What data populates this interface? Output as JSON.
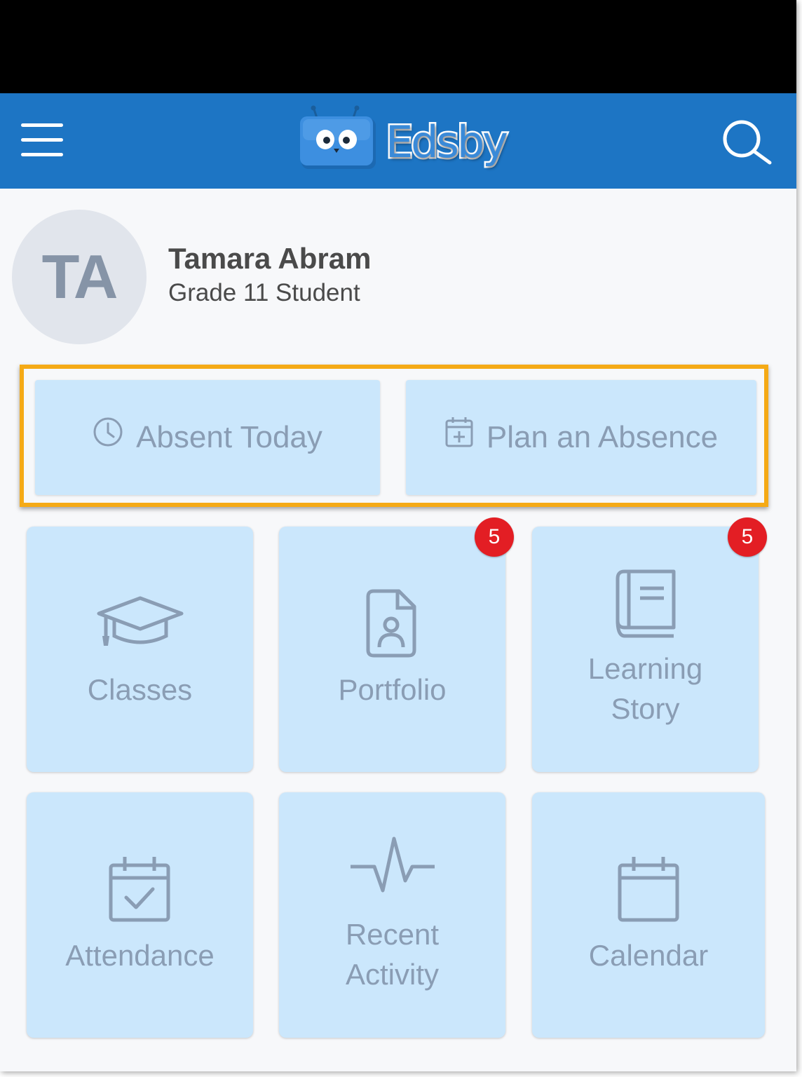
{
  "app": {
    "name": "Edsby"
  },
  "user": {
    "initials": "TA",
    "name": "Tamara Abram",
    "role": "Grade 11 Student"
  },
  "absence_actions": [
    {
      "label": "Absent Today",
      "icon": "clock-icon"
    },
    {
      "label": "Plan an Absence",
      "icon": "calendar-plus-icon"
    }
  ],
  "tiles": [
    {
      "label_line1": "Classes",
      "label_line2": "",
      "icon": "graduation-cap-icon",
      "badge": ""
    },
    {
      "label_line1": "Portfolio",
      "label_line2": "",
      "icon": "portfolio-document-icon",
      "badge": "5"
    },
    {
      "label_line1": "Learning",
      "label_line2": "Story",
      "icon": "book-icon",
      "badge": "5"
    },
    {
      "label_line1": "Attendance",
      "label_line2": "",
      "icon": "calendar-check-icon",
      "badge": ""
    },
    {
      "label_line1": "Recent",
      "label_line2": "Activity",
      "icon": "pulse-icon",
      "badge": ""
    },
    {
      "label_line1": "Calendar",
      "label_line2": "",
      "icon": "calendar-icon",
      "badge": ""
    }
  ],
  "colors": {
    "header": "#1d75c4",
    "tile": "#cbe7fc",
    "tile_text": "#8a9db4",
    "highlight": "#f5aa16",
    "badge": "#e31e24"
  }
}
